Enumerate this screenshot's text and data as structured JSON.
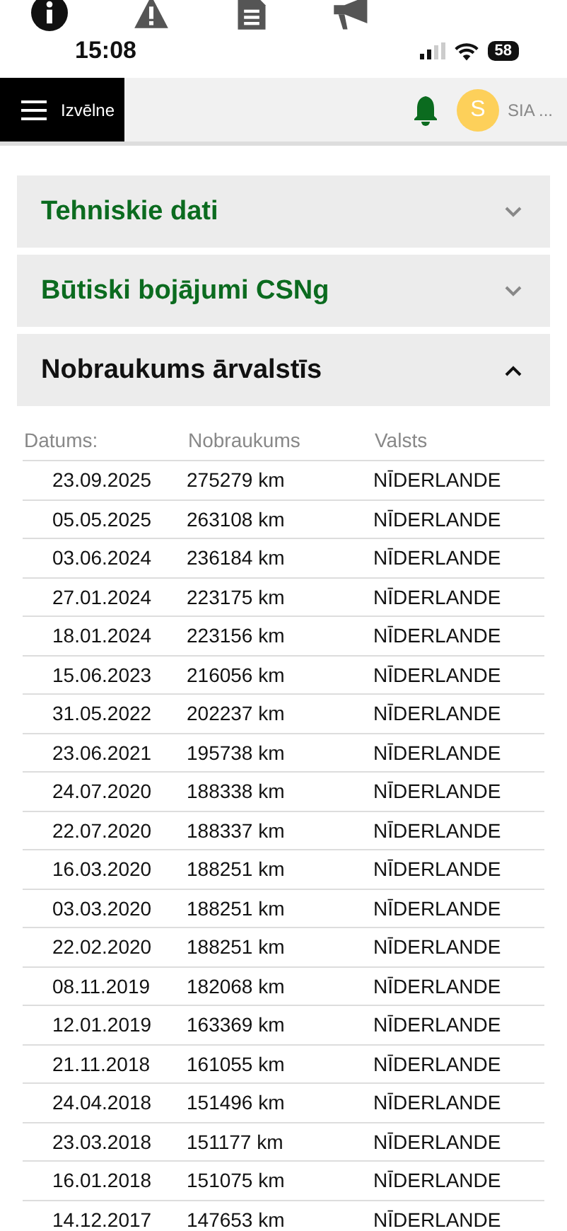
{
  "status_bar": {
    "time": "15:08",
    "battery": "58"
  },
  "header": {
    "menu_label": "Izvēlne",
    "avatar_letter": "S",
    "account": "SIA ..."
  },
  "sections": [
    {
      "title": "Tehniskie dati",
      "expanded": false
    },
    {
      "title": "Būtiski bojājumi CSNg",
      "expanded": false
    },
    {
      "title": "Nobraukums ārvalstīs",
      "expanded": true
    }
  ],
  "table": {
    "columns": [
      "Datums:",
      "Nobraukums",
      "Valsts"
    ],
    "rows": [
      [
        "23.09.2025",
        "275279 km",
        "NĪDERLANDE"
      ],
      [
        "05.05.2025",
        "263108 km",
        "NĪDERLANDE"
      ],
      [
        "03.06.2024",
        "236184 km",
        "NĪDERLANDE"
      ],
      [
        "27.01.2024",
        "223175 km",
        "NĪDERLANDE"
      ],
      [
        "18.01.2024",
        "223156 km",
        "NĪDERLANDE"
      ],
      [
        "15.06.2023",
        "216056 km",
        "NĪDERLANDE"
      ],
      [
        "31.05.2022",
        "202237 km",
        "NĪDERLANDE"
      ],
      [
        "23.06.2021",
        "195738 km",
        "NĪDERLANDE"
      ],
      [
        "24.07.2020",
        "188338 km",
        "NĪDERLANDE"
      ],
      [
        "22.07.2020",
        "188337 km",
        "NĪDERLANDE"
      ],
      [
        "16.03.2020",
        "188251 km",
        "NĪDERLANDE"
      ],
      [
        "03.03.2020",
        "188251 km",
        "NĪDERLANDE"
      ],
      [
        "22.02.2020",
        "188251 km",
        "NĪDERLANDE"
      ],
      [
        "08.11.2019",
        "182068 km",
        "NĪDERLANDE"
      ],
      [
        "12.01.2019",
        "163369 km",
        "NĪDERLANDE"
      ],
      [
        "21.11.2018",
        "161055 km",
        "NĪDERLANDE"
      ],
      [
        "24.04.2018",
        "151496 km",
        "NĪDERLANDE"
      ],
      [
        "23.03.2018",
        "151177 km",
        "NĪDERLANDE"
      ],
      [
        "16.01.2018",
        "151075 km",
        "NĪDERLANDE"
      ],
      [
        "14.12.2017",
        "147653 km",
        "NĪDERLANDE"
      ]
    ]
  }
}
